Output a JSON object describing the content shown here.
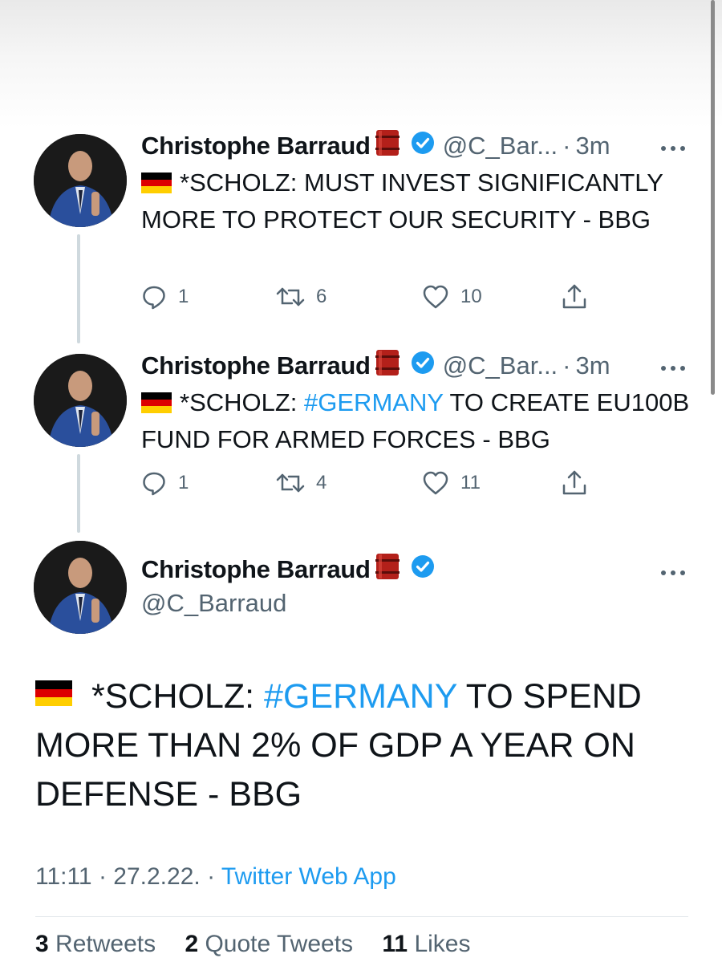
{
  "author": {
    "name": "Christophe Barraud",
    "handle_short": "@C_Bar...",
    "handle": "@C_Barraud"
  },
  "tweets": [
    {
      "time": "3m",
      "text_before": "*SCHOLZ: MUST INVEST SIGNIFICANTLY MORE TO PROTECT OUR SECURITY - BBG",
      "hashtag": "",
      "text_after": "",
      "replies": "1",
      "retweets": "6",
      "likes": "10"
    },
    {
      "time": "3m",
      "text_before": "*SCHOLZ: ",
      "hashtag": "#GERMANY",
      "text_after": " TO CREATE EU100B FUND FOR ARMED FORCES - BBG",
      "replies": "1",
      "retweets": "4",
      "likes": "11"
    }
  ],
  "main_tweet": {
    "text_before": "*SCHOLZ: ",
    "hashtag": "#GERMANY",
    "text_after": " TO SPEND MORE THAN 2% OF GDP A YEAR ON DEFENSE - BBG",
    "time": "11:11",
    "date": "27.2.22.",
    "source": "Twitter Web App"
  },
  "stats": {
    "retweets_count": "3",
    "retweets_label": "Retweets",
    "quotes_count": "2",
    "quotes_label": "Quote Tweets",
    "likes_count": "11",
    "likes_label": "Likes"
  },
  "colors": {
    "link": "#1d9bf0",
    "muted": "#536471",
    "verified": "#1d9bf0"
  },
  "icons": [
    "more-icon",
    "reply-icon",
    "retweet-icon",
    "like-icon",
    "share-icon",
    "verified-badge-icon",
    "oil-barrel-icon",
    "germany-flag-icon"
  ]
}
